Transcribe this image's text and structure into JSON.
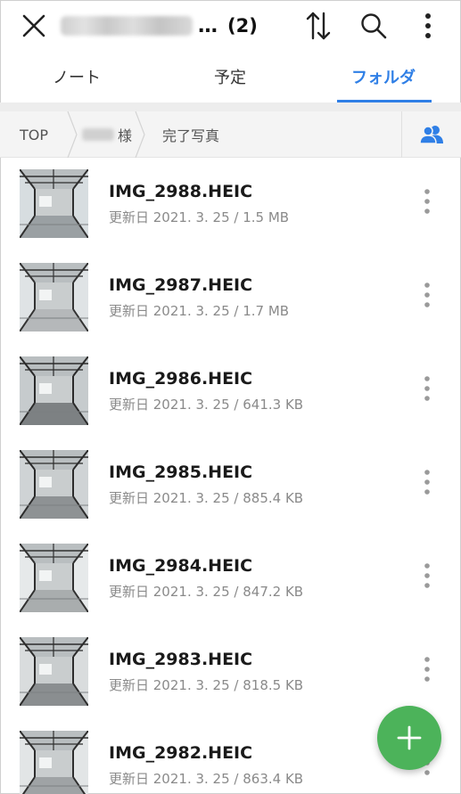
{
  "header": {
    "title_suffix": "…",
    "count": "(2)"
  },
  "tabs": [
    {
      "label": "ノート",
      "active": false
    },
    {
      "label": "予定",
      "active": false
    },
    {
      "label": "フォルダ",
      "active": true
    }
  ],
  "breadcrumb": {
    "top": "TOP",
    "client_suffix": "様",
    "folder": "完了写真"
  },
  "files": [
    {
      "name": "IMG_2988.HEIC",
      "meta": "更新日 2021. 3. 25 / 1.5 MB"
    },
    {
      "name": "IMG_2987.HEIC",
      "meta": "更新日 2021. 3. 25 / 1.7 MB"
    },
    {
      "name": "IMG_2986.HEIC",
      "meta": "更新日 2021. 3. 25 / 641.3 KB"
    },
    {
      "name": "IMG_2985.HEIC",
      "meta": "更新日 2021. 3. 25 / 885.4 KB"
    },
    {
      "name": "IMG_2984.HEIC",
      "meta": "更新日 2021. 3. 25 / 847.2 KB"
    },
    {
      "name": "IMG_2983.HEIC",
      "meta": "更新日 2021. 3. 25 / 818.5 KB"
    },
    {
      "name": "IMG_2982.HEIC",
      "meta": "更新日 2021. 3. 25 / 863.4 KB"
    }
  ],
  "icons": {
    "close": "close-icon",
    "sort": "sort-icon",
    "search": "search-icon",
    "more": "more-vertical-icon",
    "share": "people-icon",
    "add": "plus-icon"
  },
  "colors": {
    "accent": "#2f7fe6",
    "fab": "#4cb35a"
  }
}
